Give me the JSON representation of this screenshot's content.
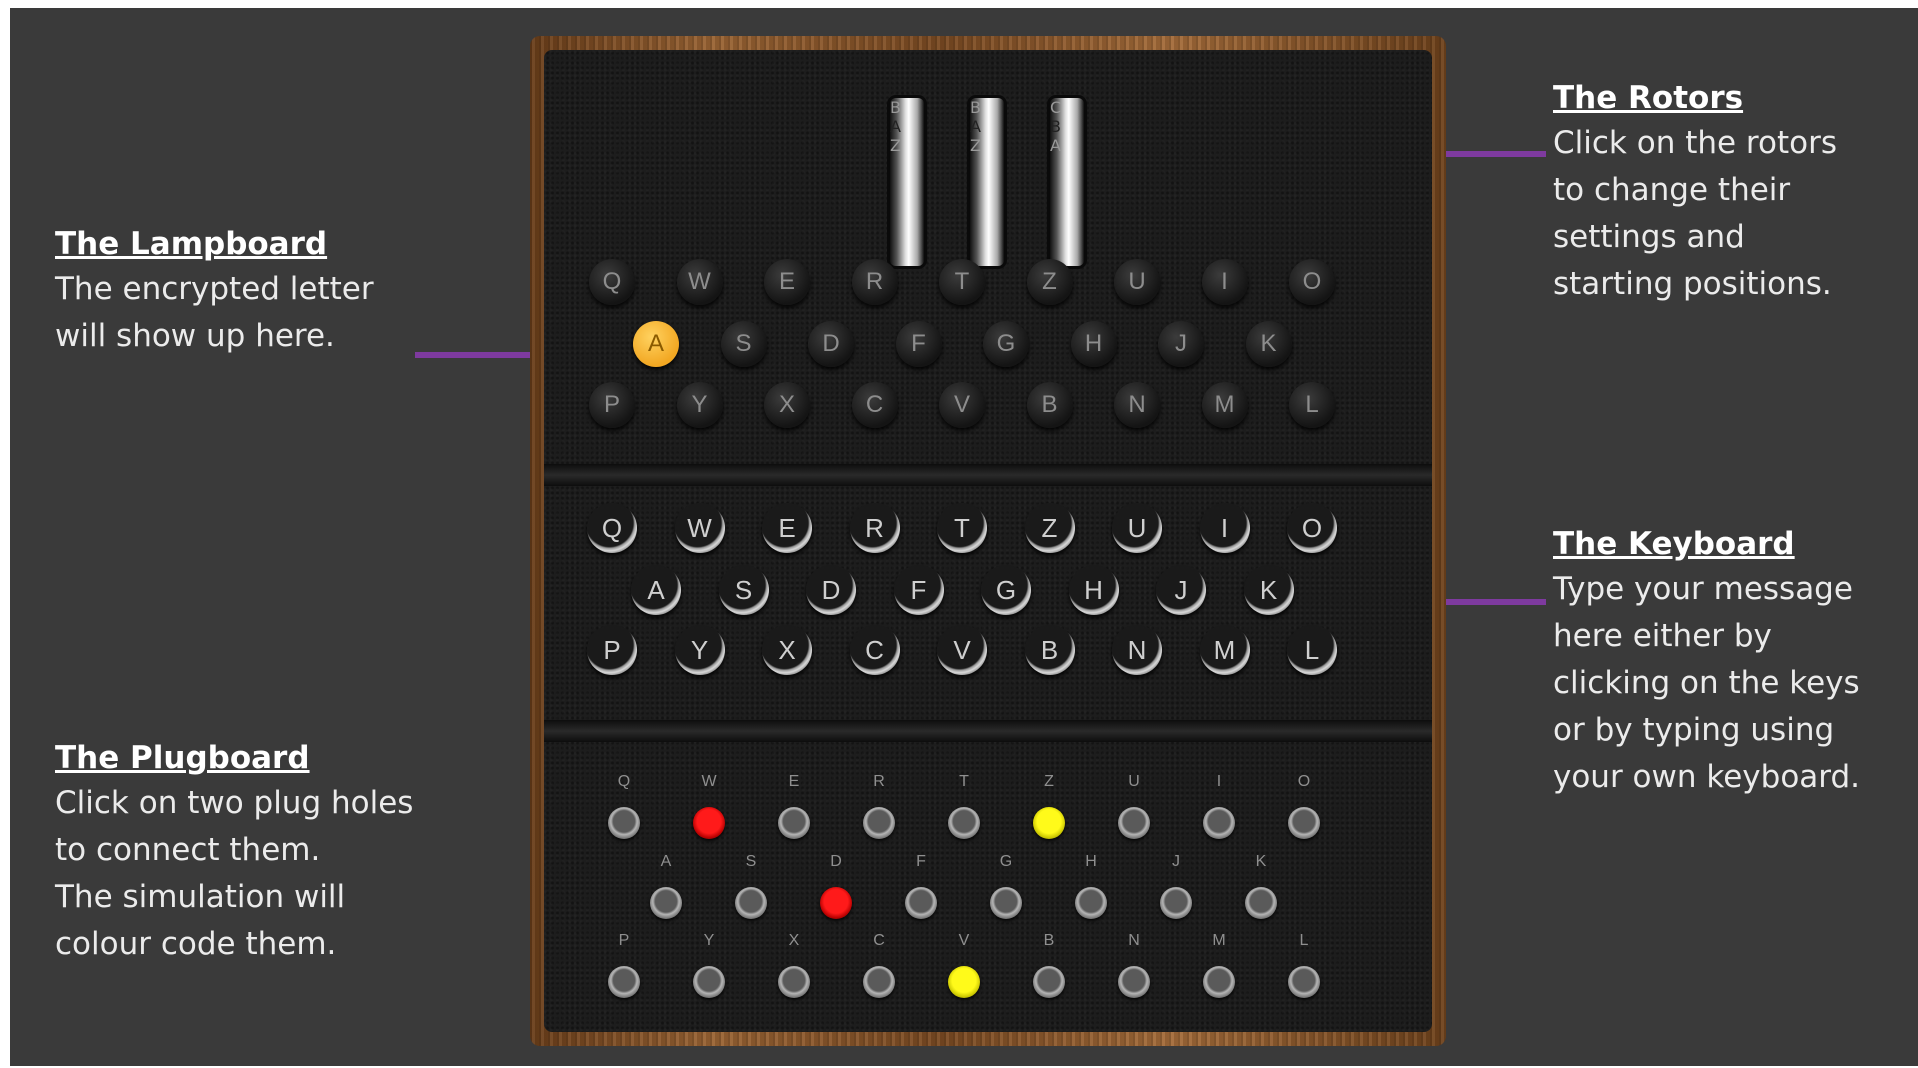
{
  "annotations": {
    "rotors": {
      "title": "The Rotors",
      "text": "Click on the rotors\nto change their\nsettings and\nstarting positions."
    },
    "lampboard": {
      "title": "The Lampboard",
      "text": "The encrypted letter\nwill show up here."
    },
    "keyboard": {
      "title": "The Keyboard",
      "text": "Type your message\nhere either by\nclicking on the keys\nor by typing using\nyour own keyboard."
    },
    "plugboard": {
      "title": "The Plugboard",
      "text": "Click on two plug holes\nto connect them.\nThe simulation will\ncolour code them."
    }
  },
  "rotors": [
    {
      "prev": "B",
      "current": "A",
      "next": "Z"
    },
    {
      "prev": "B",
      "current": "A",
      "next": "Z"
    },
    {
      "prev": "C",
      "current": "B",
      "next": "A"
    }
  ],
  "layout_rows": [
    [
      "Q",
      "W",
      "E",
      "R",
      "T",
      "Z",
      "U",
      "I",
      "O"
    ],
    [
      "A",
      "S",
      "D",
      "F",
      "G",
      "H",
      "J",
      "K"
    ],
    [
      "P",
      "Y",
      "X",
      "C",
      "V",
      "B",
      "N",
      "M",
      "L"
    ]
  ],
  "lampboard": {
    "lit_letter": "A",
    "lit_color": "#f2a722"
  },
  "plugboard": {
    "connections": [
      {
        "pair": [
          "W",
          "D"
        ],
        "color": "red"
      },
      {
        "pair": [
          "Z",
          "V"
        ],
        "color": "yellow"
      }
    ]
  },
  "colors": {
    "arrow": "#7e3a9f",
    "background": "#3a3a3a"
  }
}
